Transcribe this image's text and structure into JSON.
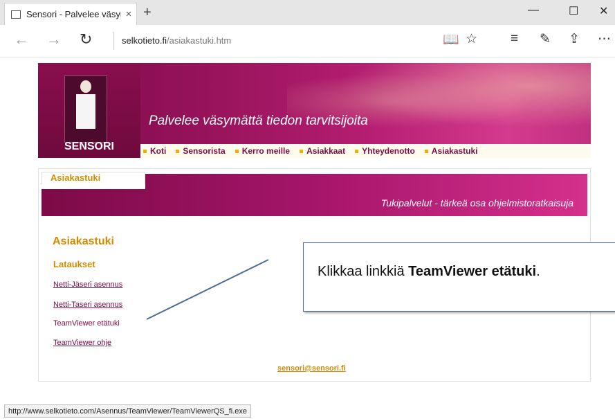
{
  "browser": {
    "tab_title": "Sensori - Palvelee väsym",
    "close_icon": "×",
    "newtab_icon": "+",
    "window": {
      "minimize": "—",
      "maximize": "☐",
      "close": "✕"
    },
    "nav": {
      "back": "←",
      "forward": "→",
      "refresh": "↻"
    },
    "url_domain": "selkotieto.fi",
    "url_path": "/asiakastuki.htm",
    "toolbar": {
      "reading_view": "📖",
      "favorite": "☆",
      "hub": "≡",
      "notes": "✎",
      "share": "⇪",
      "more": "⋯"
    }
  },
  "site": {
    "logo_text": "SENSORI",
    "slogan": "Palvelee väsymättä tiedon tarvitsijoita",
    "nav": [
      "Koti",
      "Sensorista",
      "Kerro meille",
      "Asiakkaat",
      "Yhteydenotto",
      "Asiakastuki"
    ],
    "tab_label": "Asiakastuki",
    "subtitle": "Tukipalvelut - tärkeä osa ohjelmistoratkaisuja",
    "heading": "Asiakastuki",
    "subheading": "Lataukset",
    "links": [
      "Netti-Jäseri asennus",
      "Netti-Taseri asennus",
      "TeamViewer etätuki",
      "TeamViewer ohje"
    ],
    "email": "sensori@sensori.fi"
  },
  "callout": {
    "prefix": "Klikkaa linkkiä ",
    "bold": "TeamViewer etätuki",
    "suffix": "."
  },
  "status_url": "http://www.selkotieto.com/Asennus/TeamViewer/TeamViewerQS_fi.exe",
  "colors": {
    "brand": "#96135a",
    "accent": "#d08c00",
    "link": "#7a0b43",
    "callout_border": "#4a6d99"
  }
}
